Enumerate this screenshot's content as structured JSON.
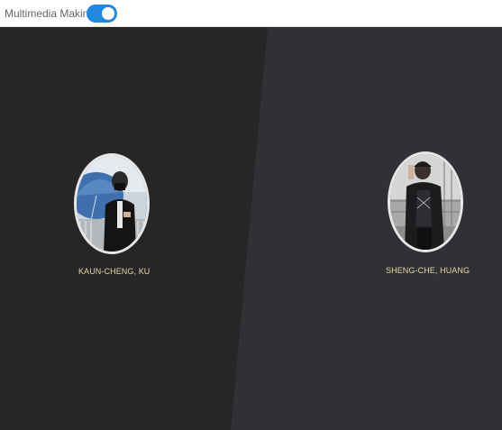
{
  "topbar": {
    "title": "Multimedia Making",
    "toggle_on": true
  },
  "colors": {
    "accent": "#1e88e5",
    "panel_left": "#262626",
    "panel_right": "#303135",
    "name_text": "#e3d9a2"
  },
  "people": [
    {
      "name": "KAUN-CHENG, KU"
    },
    {
      "name": "SHENG-CHE, HUANG"
    }
  ]
}
